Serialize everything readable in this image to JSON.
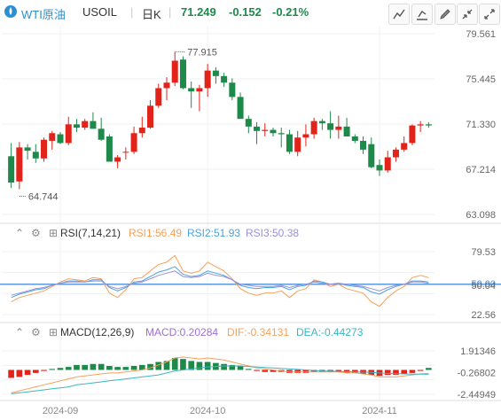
{
  "header": {
    "symbol_name": "WTI原油",
    "symbol_code": "USOIL",
    "period": "日K",
    "last_price": "71.249",
    "change": "-0.152",
    "change_pct": "-0.21%"
  },
  "colors": {
    "up": "#e2231a",
    "down": "#1e8a4a",
    "rsi1": "#f5a05a",
    "rsi2": "#4aa3df",
    "rsi3": "#9b8fd9",
    "macd": "#f5a05a",
    "dif": "#f5a05a",
    "dea": "#3cb6c2",
    "ref": "#4a90d9"
  },
  "rsi_panel": {
    "label": "RSI(7,14,21)",
    "rsi1": "RSI1:56.49",
    "rsi2": "RSI2:51.93",
    "rsi3": "RSI3:50.38"
  },
  "macd_panel": {
    "label": "MACD(12,26,9)",
    "macd": "MACD:0.20284",
    "dif": "DIF:-0.34131",
    "dea": "DEA:-0.44273"
  },
  "chart_data": [
    {
      "type": "candlestick",
      "y_ticks": [
        "79.561",
        "75.445",
        "71.330",
        "67.214",
        "63.098"
      ],
      "ylim": [
        63.098,
        79.561
      ],
      "x_ticks": [
        "2024-09",
        "2024-10",
        "2024-11"
      ],
      "annotations": {
        "high": "77.915",
        "low": "64.744"
      },
      "ohlc": [
        [
          68.4,
          69.6,
          65.5,
          66.0
        ],
        [
          66.1,
          69.7,
          65.4,
          69.2
        ],
        [
          69.2,
          69.5,
          68.1,
          68.9
        ],
        [
          68.8,
          69.5,
          67.8,
          68.2
        ],
        [
          68.2,
          70.1,
          67.9,
          69.9
        ],
        [
          69.8,
          70.7,
          69.0,
          70.5
        ],
        [
          70.4,
          70.6,
          69.5,
          69.6
        ],
        [
          69.6,
          72.0,
          69.4,
          71.3
        ],
        [
          71.3,
          71.8,
          70.6,
          71.0
        ],
        [
          71.0,
          71.8,
          70.8,
          71.6
        ],
        [
          71.6,
          72.4,
          70.9,
          70.9
        ],
        [
          70.9,
          71.9,
          69.8,
          69.9
        ],
        [
          70.2,
          70.4,
          67.9,
          67.9
        ],
        [
          67.9,
          68.5,
          67.3,
          68.3
        ],
        [
          68.8,
          69.2,
          68.1,
          68.8
        ],
        [
          68.8,
          71.1,
          68.6,
          70.5
        ],
        [
          70.5,
          72.0,
          70.1,
          71.0
        ],
        [
          71.0,
          73.5,
          70.9,
          73.0
        ],
        [
          73.0,
          75.0,
          72.8,
          74.6
        ],
        [
          74.6,
          75.6,
          73.5,
          75.1
        ],
        [
          75.1,
          77.9,
          74.8,
          77.1
        ],
        [
          77.2,
          77.5,
          74.5,
          74.6
        ],
        [
          74.6,
          75.2,
          72.8,
          74.3
        ],
        [
          74.3,
          74.9,
          72.5,
          74.6
        ],
        [
          74.6,
          76.8,
          73.8,
          76.2
        ],
        [
          76.2,
          76.5,
          75.0,
          75.7
        ],
        [
          75.7,
          76.0,
          74.7,
          75.1
        ],
        [
          75.1,
          75.5,
          73.5,
          73.8
        ],
        [
          73.8,
          74.2,
          71.9,
          71.8
        ],
        [
          71.8,
          72.1,
          70.5,
          71.1
        ],
        [
          71.1,
          71.5,
          69.5,
          70.7
        ],
        [
          70.7,
          71.4,
          70.2,
          70.8
        ],
        [
          70.8,
          71.0,
          70.2,
          70.5
        ],
        [
          70.5,
          71.0,
          69.2,
          70.4
        ],
        [
          70.4,
          70.8,
          68.6,
          68.8
        ],
        [
          68.8,
          70.7,
          68.4,
          70.1
        ],
        [
          70.1,
          71.3,
          69.3,
          70.4
        ],
        [
          70.4,
          71.9,
          70.0,
          71.6
        ],
        [
          71.6,
          71.8,
          70.8,
          71.4
        ],
        [
          71.4,
          72.5,
          70.0,
          70.8
        ],
        [
          70.8,
          72.1,
          70.0,
          71.1
        ],
        [
          71.1,
          71.9,
          70.2,
          70.2
        ],
        [
          70.2,
          70.4,
          69.6,
          69.8
        ],
        [
          69.8,
          70.2,
          68.6,
          69.0
        ],
        [
          69.5,
          70.1,
          67.3,
          67.4
        ],
        [
          67.6,
          68.1,
          66.6,
          67.1
        ],
        [
          67.1,
          68.9,
          66.9,
          68.3
        ],
        [
          68.3,
          69.2,
          67.9,
          69.0
        ],
        [
          69.0,
          70.2,
          68.8,
          69.6
        ],
        [
          69.6,
          71.3,
          69.4,
          71.2
        ],
        [
          71.2,
          71.6,
          70.6,
          71.3
        ],
        [
          71.3,
          71.5,
          71.0,
          71.2
        ]
      ]
    },
    {
      "type": "line",
      "name": "RSI",
      "y_ticks": [
        "79.53",
        "50.00",
        "50.04",
        "22.56"
      ],
      "ylim": [
        22.56,
        79.53
      ],
      "reference_line": 50.0,
      "series": [
        {
          "name": "RSI1",
          "values": [
            34,
            38,
            40,
            42,
            44,
            48,
            52,
            55,
            54,
            53,
            56,
            55,
            42,
            38,
            45,
            55,
            56,
            62,
            68,
            70,
            76,
            62,
            60,
            62,
            70,
            66,
            62,
            55,
            46,
            42,
            40,
            42,
            42,
            44,
            38,
            44,
            46,
            54,
            52,
            48,
            50,
            46,
            44,
            42,
            34,
            30,
            38,
            44,
            48,
            56,
            58,
            56
          ]
        },
        {
          "name": "RSI2",
          "values": [
            38,
            41,
            43,
            45,
            46,
            49,
            51,
            53,
            53,
            52,
            54,
            54,
            47,
            44,
            47,
            52,
            53,
            57,
            61,
            63,
            66,
            59,
            57,
            58,
            62,
            60,
            58,
            54,
            49,
            47,
            46,
            47,
            47,
            48,
            45,
            48,
            49,
            53,
            52,
            50,
            51,
            49,
            48,
            47,
            43,
            41,
            45,
            48,
            50,
            53,
            53,
            52
          ]
        },
        {
          "name": "RSI3",
          "values": [
            40,
            42,
            44,
            46,
            47,
            49,
            51,
            52,
            52,
            52,
            53,
            53,
            48,
            46,
            48,
            51,
            52,
            55,
            58,
            60,
            62,
            57,
            56,
            57,
            60,
            58,
            57,
            54,
            50,
            49,
            48,
            48,
            48,
            49,
            47,
            49,
            50,
            52,
            51,
            50,
            51,
            50,
            49,
            48,
            46,
            44,
            47,
            49,
            50,
            52,
            52,
            51
          ]
        }
      ]
    },
    {
      "type": "bar",
      "name": "MACD",
      "y_ticks": [
        "1.91346",
        "-0.26802",
        "-2.44949"
      ],
      "ylim": [
        -2.44949,
        1.91346
      ],
      "histogram": [
        -0.8,
        -0.7,
        -0.5,
        -0.3,
        -0.1,
        0.1,
        0.2,
        0.3,
        0.5,
        0.5,
        0.6,
        0.6,
        0.4,
        0.3,
        0.3,
        0.4,
        0.5,
        0.6,
        0.8,
        0.9,
        1.2,
        1.1,
        0.9,
        0.8,
        0.8,
        0.7,
        0.6,
        0.5,
        0.4,
        0.1,
        -0.1,
        -0.2,
        -0.2,
        -0.2,
        -0.3,
        -0.3,
        -0.3,
        -0.2,
        -0.2,
        -0.2,
        -0.2,
        -0.3,
        -0.3,
        -0.4,
        -0.5,
        -0.6,
        -0.5,
        -0.5,
        -0.4,
        -0.3,
        -0.1,
        0.2
      ],
      "series": [
        {
          "name": "DIF",
          "values": [
            -2.3,
            -2.1,
            -1.9,
            -1.7,
            -1.5,
            -1.3,
            -1.1,
            -0.9,
            -0.7,
            -0.6,
            -0.5,
            -0.4,
            -0.3,
            -0.3,
            -0.2,
            -0.1,
            0.0,
            0.2,
            0.5,
            0.8,
            1.2,
            1.3,
            1.2,
            1.1,
            1.2,
            1.1,
            1.0,
            0.8,
            0.6,
            0.4,
            0.2,
            0.1,
            0.0,
            -0.1,
            -0.2,
            -0.2,
            -0.2,
            -0.2,
            -0.2,
            -0.2,
            -0.2,
            -0.3,
            -0.3,
            -0.4,
            -0.5,
            -0.7,
            -0.7,
            -0.7,
            -0.6,
            -0.5,
            -0.4,
            -0.34
          ]
        },
        {
          "name": "DEA",
          "values": [
            -2.4,
            -2.3,
            -2.2,
            -2.1,
            -2.0,
            -1.9,
            -1.8,
            -1.7,
            -1.5,
            -1.4,
            -1.3,
            -1.2,
            -1.1,
            -1.0,
            -0.9,
            -0.8,
            -0.7,
            -0.6,
            -0.5,
            -0.3,
            -0.1,
            0.0,
            0.1,
            0.2,
            0.3,
            0.35,
            0.4,
            0.4,
            0.4,
            0.35,
            0.3,
            0.25,
            0.2,
            0.15,
            0.1,
            0.05,
            0.0,
            -0.05,
            -0.1,
            -0.12,
            -0.15,
            -0.18,
            -0.2,
            -0.22,
            -0.25,
            -0.3,
            -0.35,
            -0.38,
            -0.4,
            -0.42,
            -0.43,
            -0.44
          ]
        }
      ]
    }
  ]
}
